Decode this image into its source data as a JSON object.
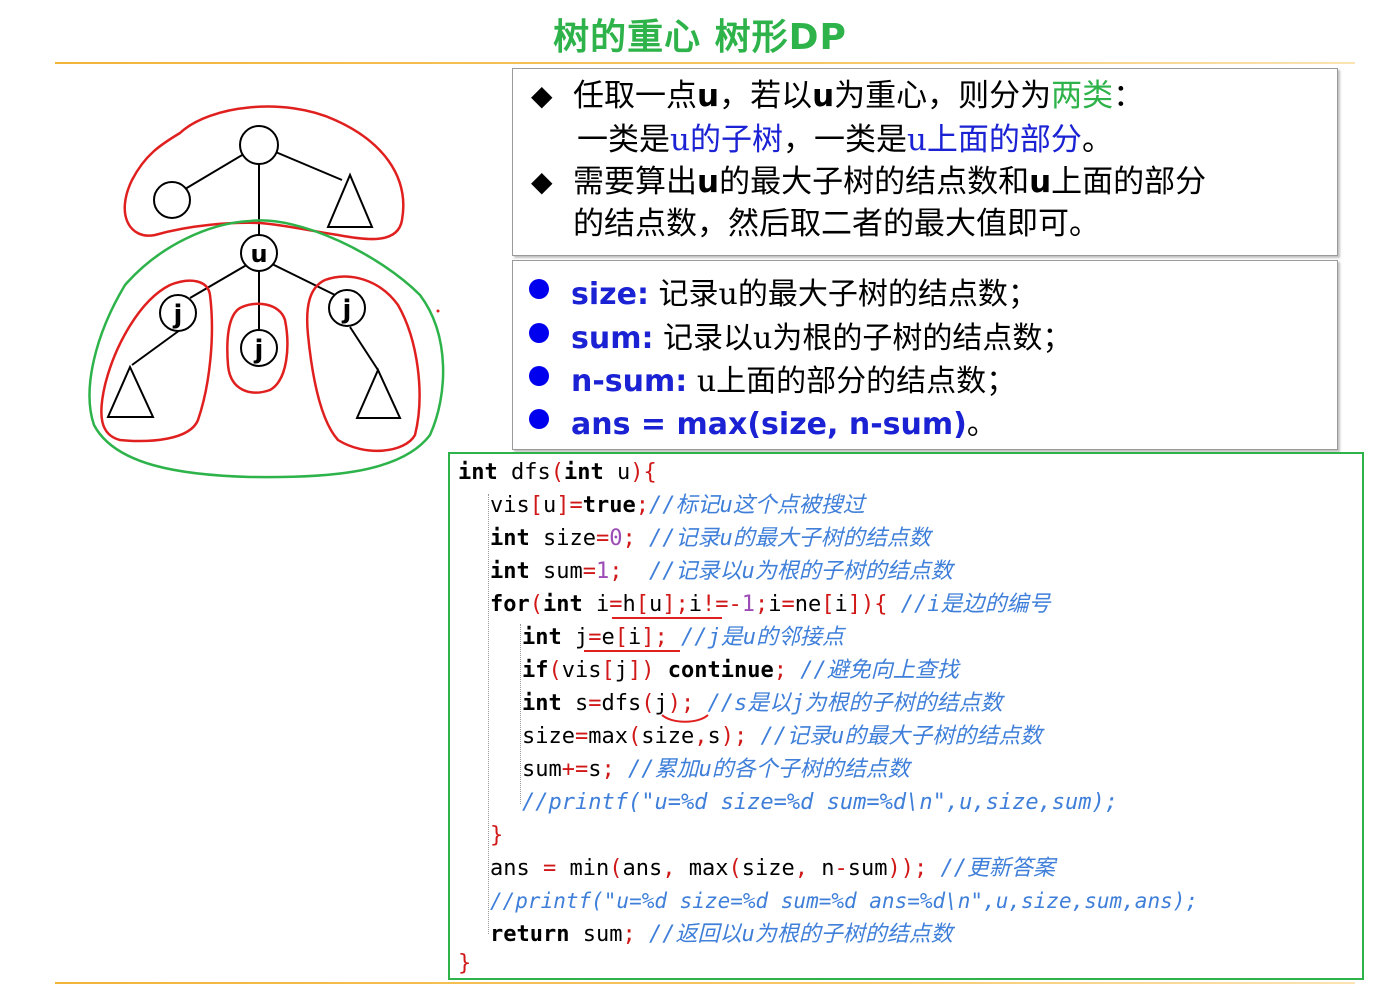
{
  "title": "树的重心  树形DP",
  "tree": {
    "nodes": [
      {
        "id": "root",
        "label": ""
      },
      {
        "id": "left-leaf",
        "label": ""
      },
      {
        "id": "u",
        "label": "u"
      },
      {
        "id": "child1",
        "label": "j"
      },
      {
        "id": "child2",
        "label": "j"
      },
      {
        "id": "child3",
        "label": "j"
      }
    ]
  },
  "box1": {
    "line1_a": "任取一点",
    "line1_u": "u",
    "line1_b": "，若以",
    "line1_u2": "u",
    "line1_c": "为重心，则分为",
    "line1_green": "两类",
    "line1_end": "：",
    "line2_a": "一类是",
    "line2_blue1": "u的子树",
    "line2_b": "，一类是",
    "line2_blue2": "u上面的部分",
    "line2_end": "。",
    "line3_a": "需要算出",
    "line3_u": "u",
    "line3_b": "的最大子树的结点数和",
    "line3_u2": "u",
    "line3_c": "上面的部分",
    "line4": "的结点数，然后取二者的最大值即可。"
  },
  "box2": {
    "items": [
      {
        "key": "size:",
        "text": "记录u的最大子树的结点数；"
      },
      {
        "key": "sum:",
        "text": "记录以u为根的子树的结点数；"
      },
      {
        "key": "n-sum:",
        "text": "u上面的部分的结点数；"
      },
      {
        "key": "ans = max(size, n-sum)",
        "text": "。"
      }
    ]
  },
  "code": {
    "l1": {
      "a": "int",
      "b": " dfs",
      "c": "(",
      "d": "int",
      "e": " u",
      "f": "){"
    },
    "l2": {
      "a": "vis",
      "b": "[",
      "c": "u",
      "d": "]=",
      "e": "true",
      "f": ";",
      "cm": "//标记u这个点被搜过"
    },
    "l3": {
      "a": "int",
      "b": " size",
      "c": "=",
      "d": "0",
      "e": ";",
      "cm": " //记录u的最大子树的结点数"
    },
    "l4": {
      "a": "int",
      "b": " sum",
      "c": "=",
      "d": "1",
      "e": ";",
      "cm": "  //记录以u为根的子树的结点数"
    },
    "l5": {
      "a": "for",
      "b": "(",
      "c": "int",
      "d": " i",
      "e": "=",
      "f": "h",
      "g": "[",
      "h": "u",
      "i": "];",
      "j": "i",
      "k": "!=-",
      "l": "1",
      "m": ";",
      "n": "i",
      "o": "=",
      "p": "ne",
      "q": "[",
      "r": "i",
      "s": "]){",
      "cm": " //i是边的编号"
    },
    "l6": {
      "a": "int",
      "b": " j",
      "c": "=",
      "d": "e",
      "e": "[",
      "f": "i",
      "g": "];",
      "cm": " //j是u的邻接点"
    },
    "l7": {
      "a": "if",
      "b": "(",
      "c": "vis",
      "d": "[",
      "e": "j",
      "f": "])",
      "g": " continue",
      "h": ";",
      "cm": " //避免向上查找"
    },
    "l8": {
      "a": "int",
      "b": " s",
      "c": "=",
      "d": "dfs",
      "e": "(",
      "f": "j",
      "g": ");",
      "cm": " //s是以j为根的子树的结点数"
    },
    "l9": {
      "a": "size",
      "b": "=",
      "c": "max",
      "d": "(",
      "e": "size",
      "f": ",",
      "g": "s",
      "h": ");",
      "cm": " //记录u的最大子树的结点数"
    },
    "l10": {
      "a": "sum",
      "b": "+=",
      "c": "s",
      "d": ";",
      "cm": " //累加u的各个子树的结点数"
    },
    "l11": {
      "cm": "//printf(\"u=%d size=%d sum=%d\\n\",u,size,sum);"
    },
    "l12": {
      "a": "}"
    },
    "l13": {
      "a": "ans",
      "b": " = ",
      "c": "min",
      "d": "(",
      "e": "ans",
      "f": ", ",
      "g": "max",
      "h": "(",
      "i": "size",
      "j": ", ",
      "k": "n",
      "l": "-",
      "m": "sum",
      "n": "));",
      "cm": " //更新答案"
    },
    "l14": {
      "cm": "//printf(\"u=%d size=%d sum=%d ans=%d\\n\",u,size,sum,ans);"
    },
    "l15": {
      "a": "return",
      "b": " sum",
      "c": ";",
      "cm": " //返回以u为根的子树的结点数"
    },
    "l16": {
      "a": "}"
    }
  },
  "colors": {
    "title": "#2db34a",
    "blue_text": "#1a22d4",
    "green_text": "#2db34a",
    "code_border": "#2db34a",
    "comment": "#3f7fd9",
    "operator": "#d01818",
    "number": "#9b4bb6",
    "red_outline": "#e0201f",
    "green_outline": "#2db34a"
  }
}
